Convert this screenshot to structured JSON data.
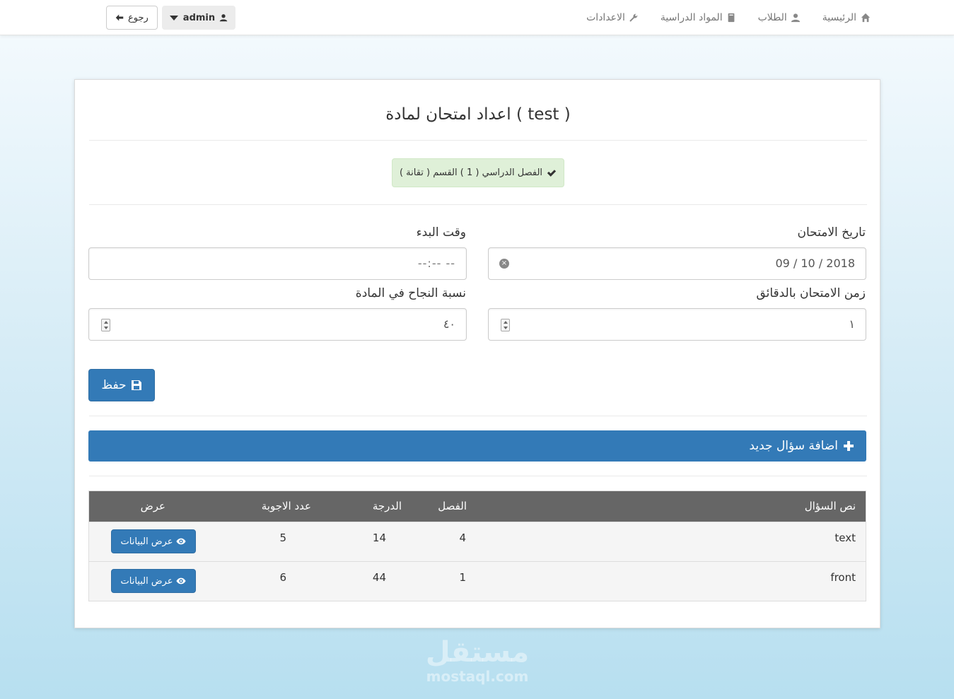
{
  "nav": {
    "items": [
      {
        "label": "الرئيسية",
        "icon": "home-icon"
      },
      {
        "label": "الطلاب",
        "icon": "user-icon"
      },
      {
        "label": "المواد الدراسية",
        "icon": "book-icon"
      },
      {
        "label": "الاعدادات",
        "icon": "wrench-icon"
      }
    ],
    "user_label": "admin",
    "back_label": "رجوع"
  },
  "page": {
    "title": "اعداد امتحان لمادة ( test )",
    "badge": "الفصل الدراسي ( 1 ) القسم ( تقانة )"
  },
  "form": {
    "exam_date_label": "تاريخ الامتحان",
    "exam_date_value": "09 / 10 / 2018",
    "start_time_label": "وقت البدء",
    "start_time_placeholder": "--:--   --",
    "duration_label": "زمن الامتحان بالدقائق",
    "duration_value": "١",
    "pass_rate_label": "نسبة النجاح في المادة",
    "pass_rate_value": "٤٠",
    "save_label": "حفظ"
  },
  "add_question_label": "اضافة سؤال جديد",
  "table": {
    "headers": {
      "text": "نص السؤال",
      "chapter": "الفصل",
      "grade": "الدرجة",
      "answers": "عدد الاجوبة",
      "view": "عرض"
    },
    "rows": [
      {
        "text": "text",
        "chapter": "4",
        "grade": "14",
        "answers": "5",
        "view_label": "عرض البيانات"
      },
      {
        "text": "front",
        "chapter": "1",
        "grade": "44",
        "answers": "6",
        "view_label": "عرض البيانات"
      }
    ]
  },
  "watermark": {
    "ar": "مستقل",
    "en": "mostaql.com"
  }
}
